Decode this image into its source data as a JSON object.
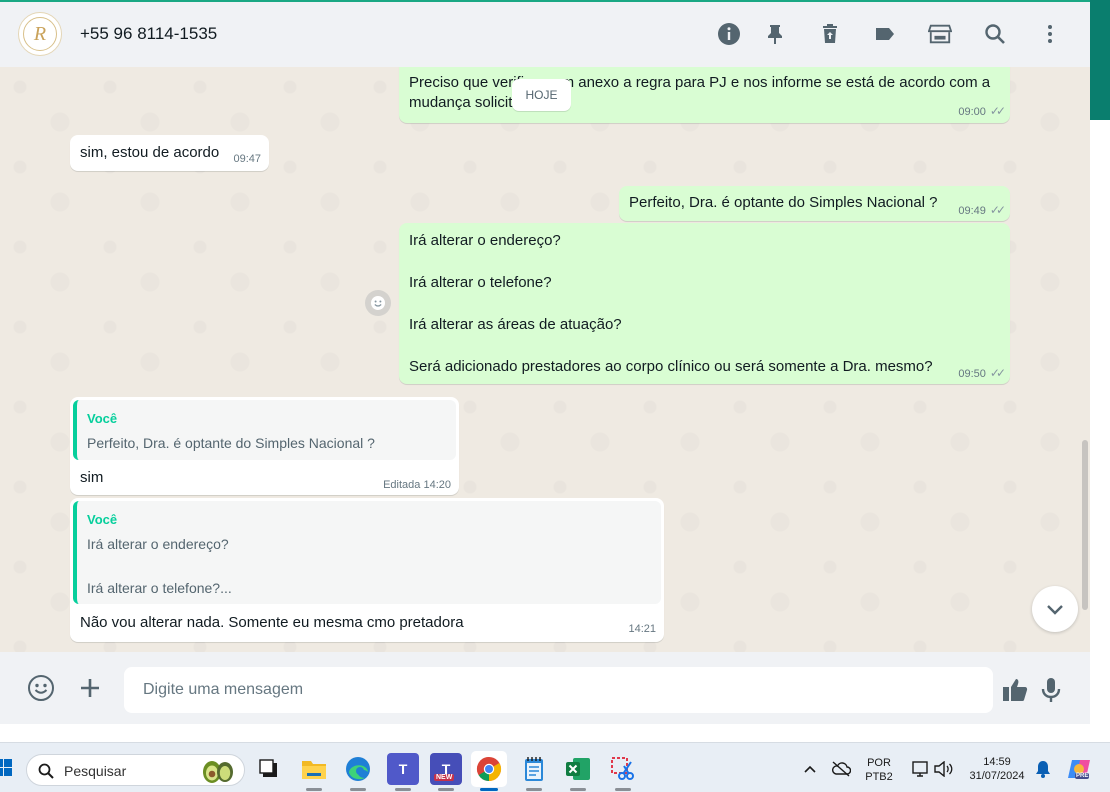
{
  "header": {
    "contact_name": "+55 96 8114-1535",
    "avatar_letter": "R",
    "icons": [
      "info-icon",
      "pin-icon",
      "delete-icon",
      "label-icon",
      "store-icon",
      "search-icon",
      "menu-icon"
    ]
  },
  "chat": {
    "date_badge": "HOJE",
    "messages": [
      {
        "direction": "out",
        "lines": [
          "Preciso que verifique em anexo a regra para PJ e nos informe se está de acordo com a",
          "mudança solicitada."
        ],
        "time": "09:00",
        "status": "read"
      },
      {
        "direction": "in",
        "lines": [
          "sim, estou de acordo"
        ],
        "time": "09:47"
      },
      {
        "direction": "out",
        "lines": [
          "Perfeito, Dra. é optante do Simples Nacional ?"
        ],
        "time": "09:49",
        "status": "read"
      },
      {
        "direction": "out",
        "lines": [
          "Irá alterar o endereço?",
          "Irá alterar o telefone?",
          "Irá alterar as áreas de atuação?",
          "Será adicionado prestadores ao corpo clínico ou será somente a Dra. mesmo?"
        ],
        "time": "09:50",
        "status": "read"
      },
      {
        "direction": "in",
        "quote_author": "Você",
        "quote_lines": [
          "Perfeito, Dra. é optante do Simples Nacional ?"
        ],
        "lines": [
          "sim"
        ],
        "edited_label": "Editada",
        "time": "14:20"
      },
      {
        "direction": "in",
        "quote_author": "Você",
        "quote_lines": [
          "Irá alterar o endereço?",
          "Irá alterar o telefone?..."
        ],
        "lines": [
          "Não vou alterar nada. Somente eu mesma cmo pretadora"
        ],
        "time": "14:21"
      }
    ]
  },
  "composer": {
    "placeholder": "Digite uma mensagem"
  },
  "taskbar": {
    "search_placeholder": "Pesquisar",
    "apps": [
      "task-view",
      "file-explorer",
      "edge",
      "teams",
      "teams-new",
      "chrome",
      "notepad",
      "excel",
      "snipping-tool"
    ],
    "badge_new": "NEW",
    "tray": {
      "language": "POR",
      "layout": "PTB2",
      "time": "14:59",
      "date": "31/07/2024",
      "copilot_badge": "PRE"
    }
  },
  "colors": {
    "accent": "#06cf9c",
    "outgoing_bubble": "#d9fdd3",
    "incoming_bubble": "#ffffff",
    "chat_background": "#efeae2",
    "header_background": "#f0f2f5"
  }
}
